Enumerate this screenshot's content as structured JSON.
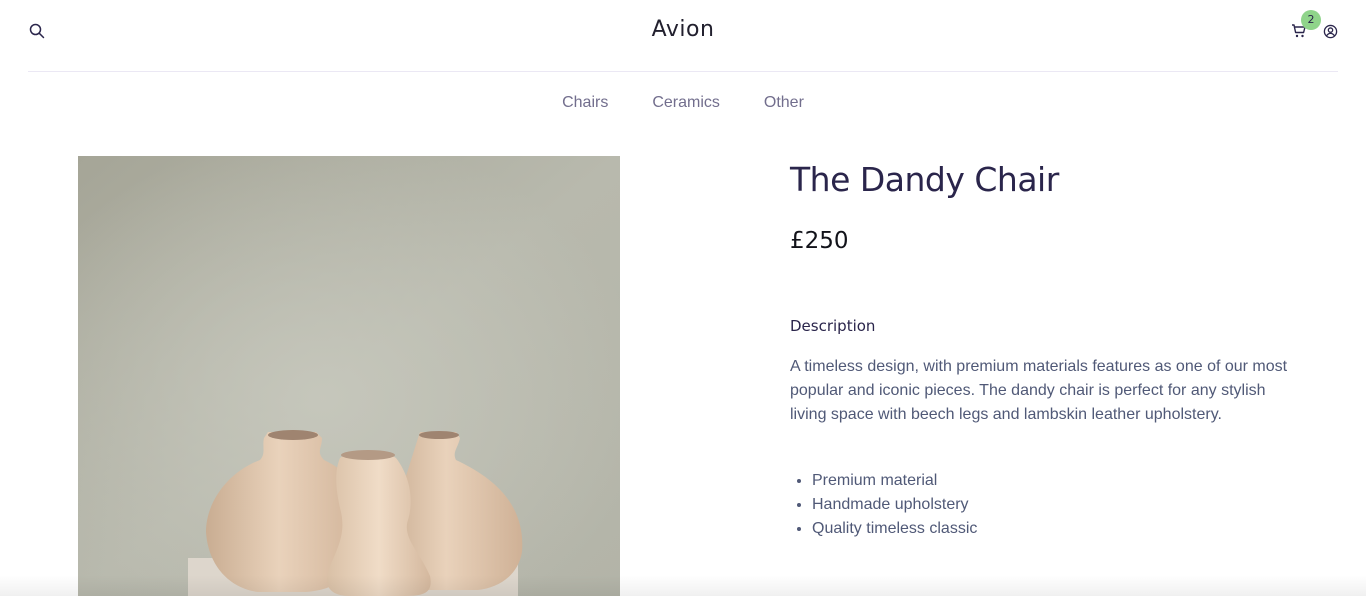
{
  "header": {
    "logo": "Avion",
    "cart_count": "2",
    "icons": [
      "search-icon",
      "cart-icon",
      "user-icon"
    ]
  },
  "nav": {
    "items": [
      {
        "label": "Chairs"
      },
      {
        "label": "Ceramics"
      },
      {
        "label": "Other"
      }
    ]
  },
  "product": {
    "title": "The Dandy Chair",
    "price": "£250",
    "description_heading": "Description",
    "description": "A timeless design, with premium materials features as one of our most popular and iconic pieces. The dandy chair is perfect for any stylish living space with beech legs and lambskin leather upholstery.",
    "features": [
      "Premium material",
      "Handmade upholstery",
      "Quality timeless classic"
    ]
  },
  "colors": {
    "brand_dark": "#2A254B",
    "muted_text": "#726E8D",
    "badge": "#8fd48a"
  }
}
